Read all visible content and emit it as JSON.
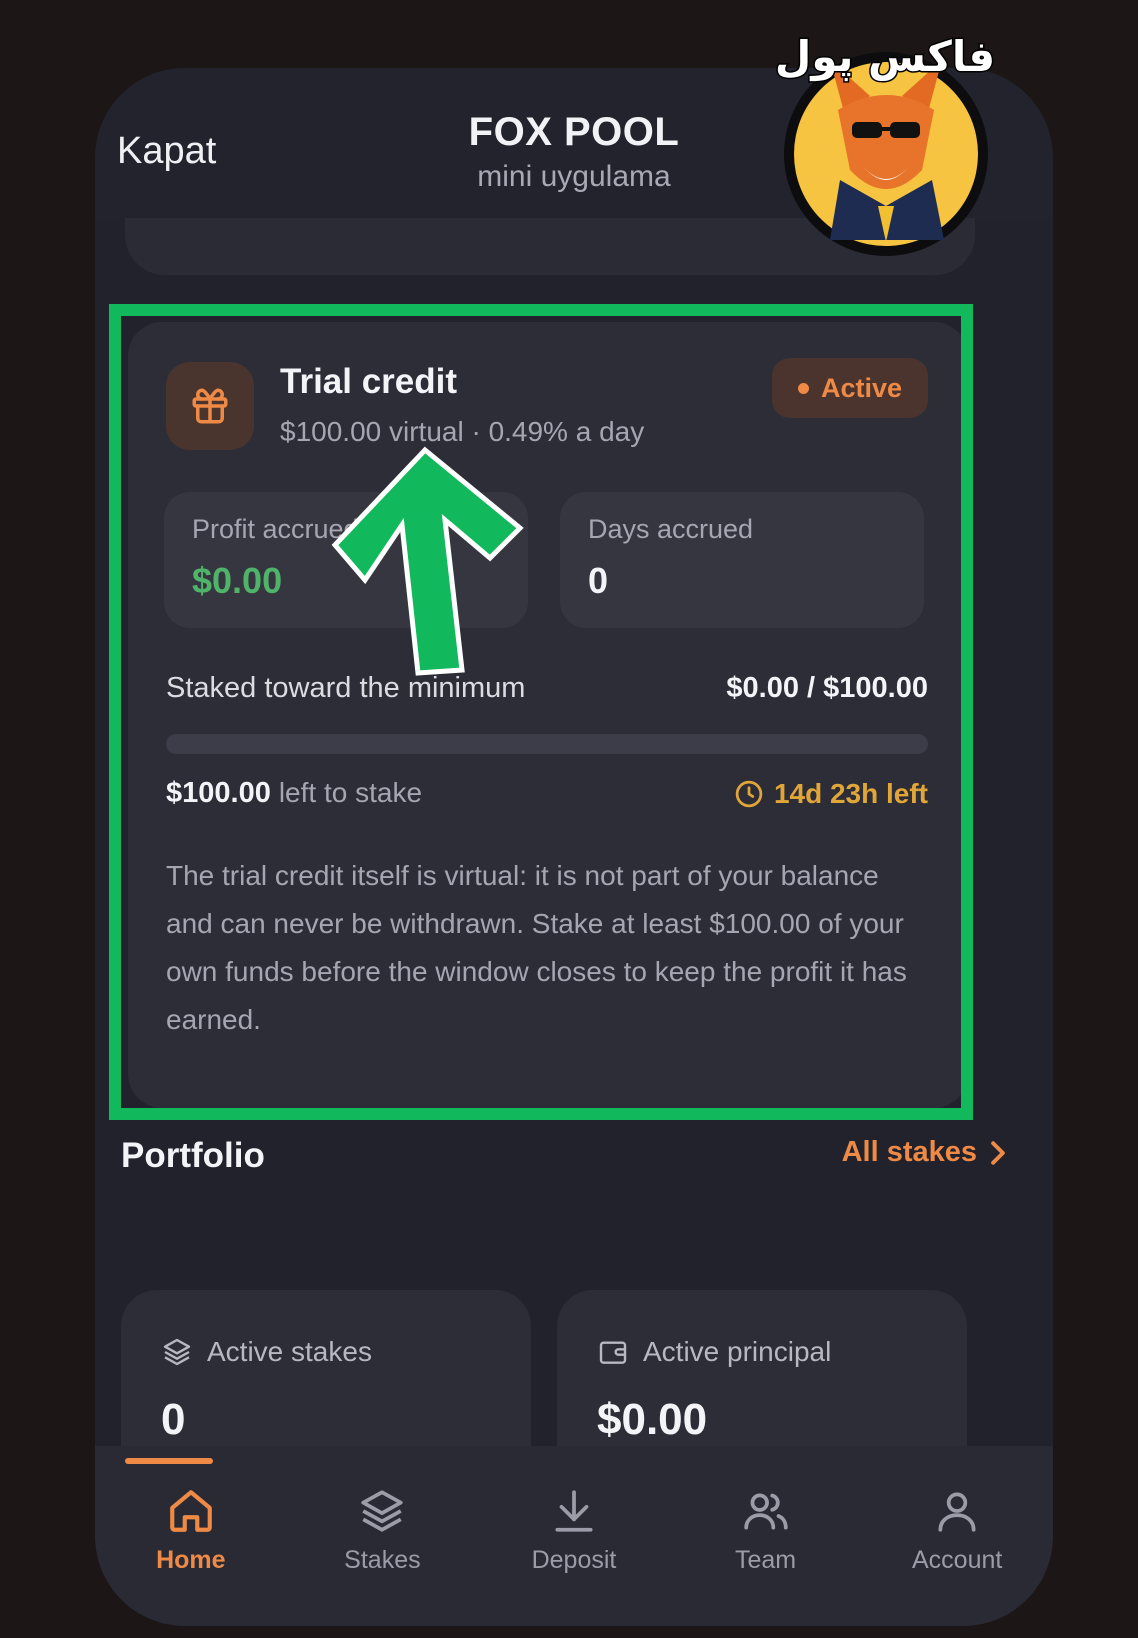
{
  "header": {
    "close_label": "Kapat",
    "title": "FOX POOL",
    "subtitle": "mini uygulama"
  },
  "logo": {
    "text": "فاکس پول",
    "icon": "fox-mascot-logo"
  },
  "trial_credit": {
    "title": "Trial credit",
    "subtitle": "$100.00 virtual · 0.49% a day",
    "status": "Active",
    "profit_label": "Profit accrued",
    "profit_value": "$0.00",
    "days_label": "Days accrued",
    "days_value": "0",
    "staked_label": "Staked toward the minimum",
    "staked_value": "$0.00 / $100.00",
    "staked_progress": 0,
    "left_amount": "$100.00",
    "left_text": "left to stake",
    "time_left": "14d 23h left",
    "info": "The trial credit itself is virtual: it is not part of your balance and can never be withdrawn. Stake at least $100.00 of your own funds before the window closes to keep the profit it has earned."
  },
  "portfolio": {
    "title": "Portfolio",
    "link": "All stakes",
    "cards": [
      {
        "label": "Active stakes",
        "value": "0",
        "icon": "layers-icon"
      },
      {
        "label": "Active principal",
        "value": "$0.00",
        "icon": "wallet-icon"
      }
    ]
  },
  "nav": {
    "items": [
      {
        "label": "Home",
        "icon": "home-icon",
        "active": true
      },
      {
        "label": "Stakes",
        "icon": "layers-icon",
        "active": false
      },
      {
        "label": "Deposit",
        "icon": "download-icon",
        "active": false
      },
      {
        "label": "Team",
        "icon": "users-icon",
        "active": false
      },
      {
        "label": "Account",
        "icon": "user-icon",
        "active": false
      }
    ]
  },
  "colors": {
    "accent": "#ee8a45",
    "profit_green": "#4fb46a",
    "timer_yellow": "#e0a637",
    "highlight_green": "#12b85c",
    "card_bg": "#2d2d38"
  }
}
